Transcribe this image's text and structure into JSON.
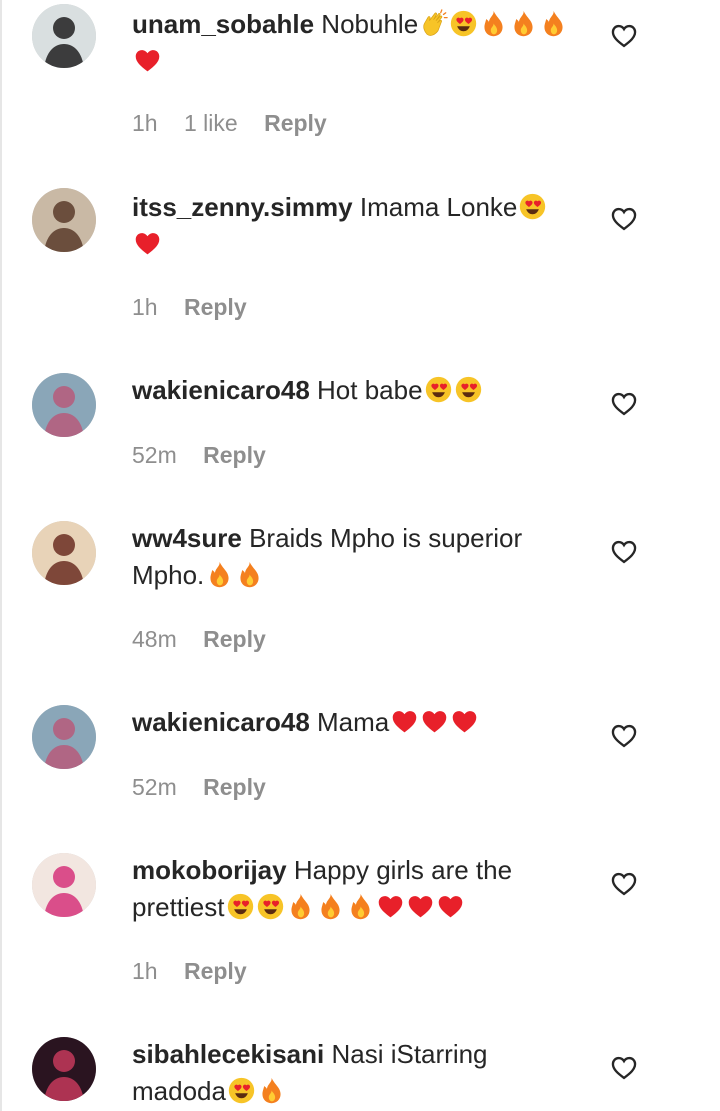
{
  "comments": [
    {
      "username": "unam_sobahle",
      "text": "Nobuhle",
      "emojis": [
        "clap",
        "heart-eyes",
        "fire",
        "fire",
        "fire",
        "red-heart"
      ],
      "time": "1h",
      "likes": "1 like",
      "reply": "Reply",
      "avatar_colors": [
        "#d9dfe0",
        "#202020"
      ]
    },
    {
      "username": "itss_zenny.simmy",
      "text": "Imama Lonke",
      "emojis": [
        "heart-eyes",
        "red-heart"
      ],
      "time": "1h",
      "likes": "",
      "reply": "Reply",
      "avatar_colors": [
        "#c9b9a5",
        "#5a3b2a"
      ]
    },
    {
      "username": "wakienicaro48",
      "text": "Hot babe",
      "emojis": [
        "heart-eyes",
        "heart-eyes"
      ],
      "time": "52m",
      "likes": "",
      "reply": "Reply",
      "avatar_colors": [
        "#8aa6b8",
        "#b65a7a"
      ]
    },
    {
      "username": "ww4sure",
      "text": "Braids Mpho is superior Mpho.",
      "emojis": [
        "fire",
        "fire"
      ],
      "time": "48m",
      "likes": "",
      "reply": "Reply",
      "avatar_colors": [
        "#e8d3b8",
        "#6b2e22"
      ]
    },
    {
      "username": "wakienicaro48",
      "text": "Mama",
      "emojis": [
        "red-heart",
        "red-heart",
        "red-heart"
      ],
      "time": "52m",
      "likes": "",
      "reply": "Reply",
      "avatar_colors": [
        "#8aa6b8",
        "#b65a7a"
      ]
    },
    {
      "username": "mokoborijay",
      "text": "Happy girls are the prettiest",
      "emojis": [
        "heart-eyes",
        "heart-eyes",
        "fire",
        "fire",
        "fire",
        "red-heart",
        "red-heart",
        "red-heart"
      ],
      "time": "1h",
      "likes": "",
      "reply": "Reply",
      "avatar_colors": [
        "#f2e6e0",
        "#d6337a"
      ]
    },
    {
      "username": "sibahlecekisani",
      "text": "Nasi iStarring madoda",
      "emojis": [
        "heart-eyes",
        "fire"
      ],
      "time": "",
      "likes": "",
      "reply": "",
      "avatar_colors": [
        "#2a1420",
        "#c4385c"
      ]
    }
  ],
  "colors": {
    "text": "#262626",
    "meta": "#8e8e8e",
    "heart_red": "#e8202a",
    "fire_orange": "#f4801f",
    "emoji_yellow": "#f7c427"
  }
}
